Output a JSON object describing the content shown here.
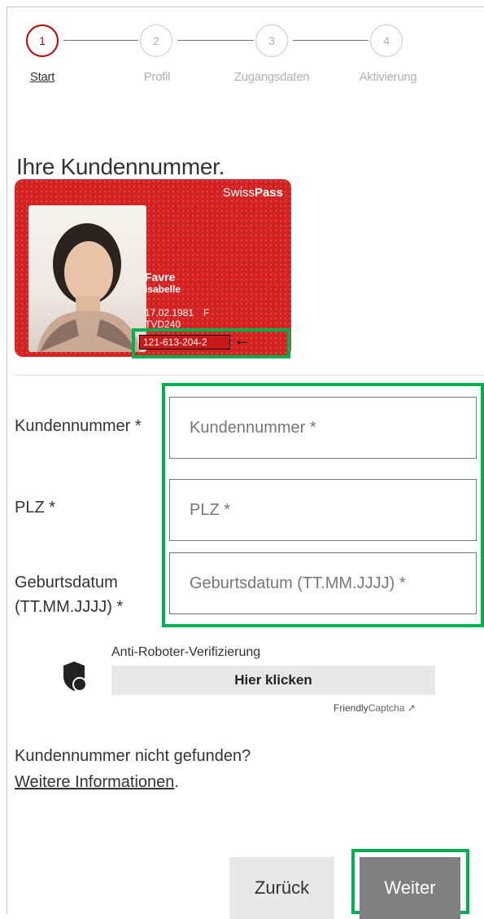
{
  "stepper": {
    "steps": [
      {
        "number": "1",
        "label": "Start"
      },
      {
        "number": "2",
        "label": "Profil"
      },
      {
        "number": "3",
        "label": "Zugangsdaten"
      },
      {
        "number": "4",
        "label": "Aktivierung"
      }
    ]
  },
  "page_title": "Ihre Kundennummer.",
  "card": {
    "brand_light": "Swiss",
    "brand_bold": "Pass",
    "last_name": "Favre",
    "first_name": "Isabelle",
    "birth_date": "17.02.1981",
    "sex": "F",
    "code": "TVD240",
    "customer_number": "121-613-204-2",
    "arrow": "←"
  },
  "form": {
    "customer_number": {
      "label": "Kundennummer *",
      "placeholder": "Kundennummer *",
      "value": ""
    },
    "zip": {
      "label": "PLZ *",
      "placeholder": "PLZ *",
      "value": ""
    },
    "birth_date": {
      "label": "Geburtsdatum (TT.MM.JJJJ) *",
      "placeholder": "Geburtsdatum (TT.MM.JJJJ) *",
      "value": ""
    }
  },
  "captcha": {
    "title": "Anti-Roboter-Verifizierung",
    "button_label": "Hier klicken",
    "brand_bold": "Friendly",
    "brand_light": "Captcha",
    "link_icon": "↗"
  },
  "help": {
    "text": "Kundennummer nicht gefunden?",
    "link_label": "Weitere Informationen",
    "suffix": "."
  },
  "buttons": {
    "back_label": "Zurück",
    "next_label": "Weiter"
  },
  "colors": {
    "accent": "#c00000",
    "card_red": "#d42222",
    "highlight_green": "#00b050",
    "next_button": "#808080",
    "back_button": "#e8e8e8"
  }
}
